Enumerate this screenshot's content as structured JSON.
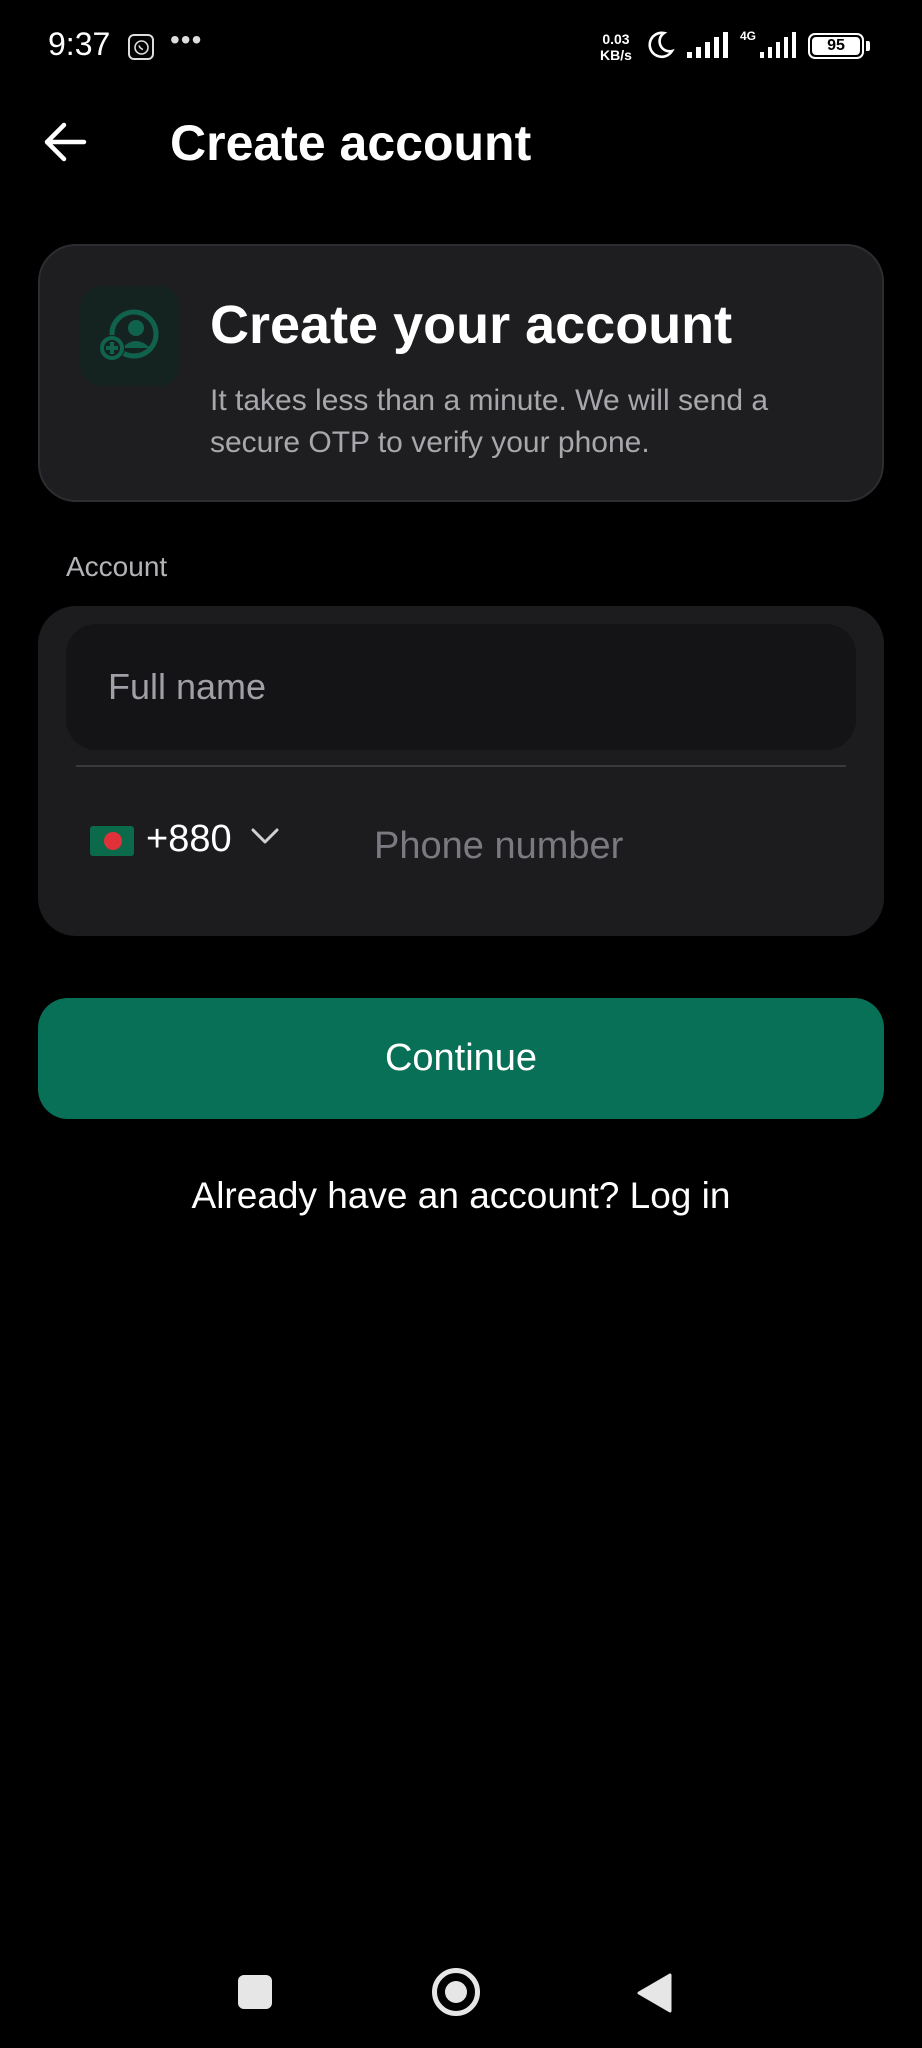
{
  "status_bar": {
    "time": "9:37",
    "net_speed_value": "0.03",
    "net_speed_unit": "KB/s",
    "network_type": "4G",
    "battery_level": "95",
    "icons": [
      "whatsapp-icon",
      "more-dots-icon",
      "moon-icon",
      "signal-icon",
      "battery-icon"
    ]
  },
  "header": {
    "title": "Create account",
    "back_icon": "arrow-left-icon"
  },
  "info_card": {
    "icon": "add-user-icon",
    "title": "Create your account",
    "text": "It takes less than a minute. We will send a secure OTP to verify your phone."
  },
  "form": {
    "section_label": "Account",
    "full_name_value": "",
    "full_name_placeholder": "Full name",
    "country_flag": "bangladesh-flag",
    "dial_code": "+880",
    "phone_value": "",
    "phone_placeholder": "Phone number"
  },
  "actions": {
    "continue_label": "Continue",
    "login_prompt": "Already have an account? Log in"
  },
  "nav_bar": {
    "icons": [
      "recents-square-icon",
      "home-circle-icon",
      "back-triangle-icon"
    ]
  },
  "colors": {
    "background": "#000000",
    "card": "#1e1e20",
    "accent": "#087056",
    "muted_text": "#a8a8ac"
  }
}
